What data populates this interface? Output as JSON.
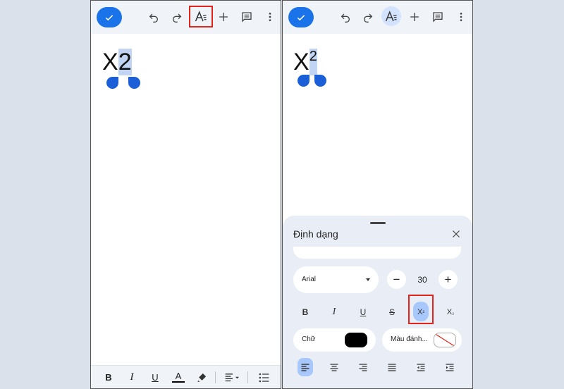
{
  "colors": {
    "accent": "#1a73e8",
    "selection": "#c2d4f3",
    "highlight_box": "#e1251b",
    "active_chip": "#a8c7fa",
    "toolbar_bg": "#f0f4f9",
    "sheet_bg": "#e9eef6"
  },
  "left_screen": {
    "toolbar": {
      "icons": [
        "check-icon",
        "undo-icon",
        "redo-icon",
        "text-format-icon",
        "plus-icon",
        "comment-icon",
        "more-vert-icon"
      ],
      "highlighted": "text-format-icon"
    },
    "doc": {
      "base_text": "X",
      "selected_text": "2"
    },
    "bottom_toolbar": {
      "bold": "B",
      "italic": "I",
      "underline": "U",
      "text_color": "A",
      "icons": [
        "highlighter-icon",
        "align-icon",
        "bulleted-list-icon"
      ]
    }
  },
  "right_screen": {
    "toolbar": {
      "icons": [
        "check-icon",
        "undo-icon",
        "redo-icon",
        "text-format-icon",
        "plus-icon",
        "comment-icon",
        "more-vert-icon"
      ],
      "active": "text-format-icon"
    },
    "doc": {
      "base_text": "X",
      "superscript_text": "2"
    },
    "format_sheet": {
      "title": "Định dạng",
      "font_name": "Arial",
      "font_size": "30",
      "decrease": "−",
      "increase": "+",
      "styles": {
        "bold": "B",
        "italic": "I",
        "underline": "U",
        "strikethrough": "S",
        "superscript_base": "X",
        "superscript_mark": "²",
        "subscript_base": "X",
        "subscript_mark": "₂"
      },
      "active_style": "superscript",
      "text_color_label": "Chữ",
      "text_color": "#000000",
      "highlight_label": "Màu đánh...",
      "highlight_color": "none",
      "alignment_options": [
        "align-left-icon",
        "align-center-icon",
        "align-right-icon",
        "align-justify-icon",
        "indent-decrease-icon",
        "indent-increase-icon"
      ],
      "active_alignment": "align-left-icon"
    }
  }
}
